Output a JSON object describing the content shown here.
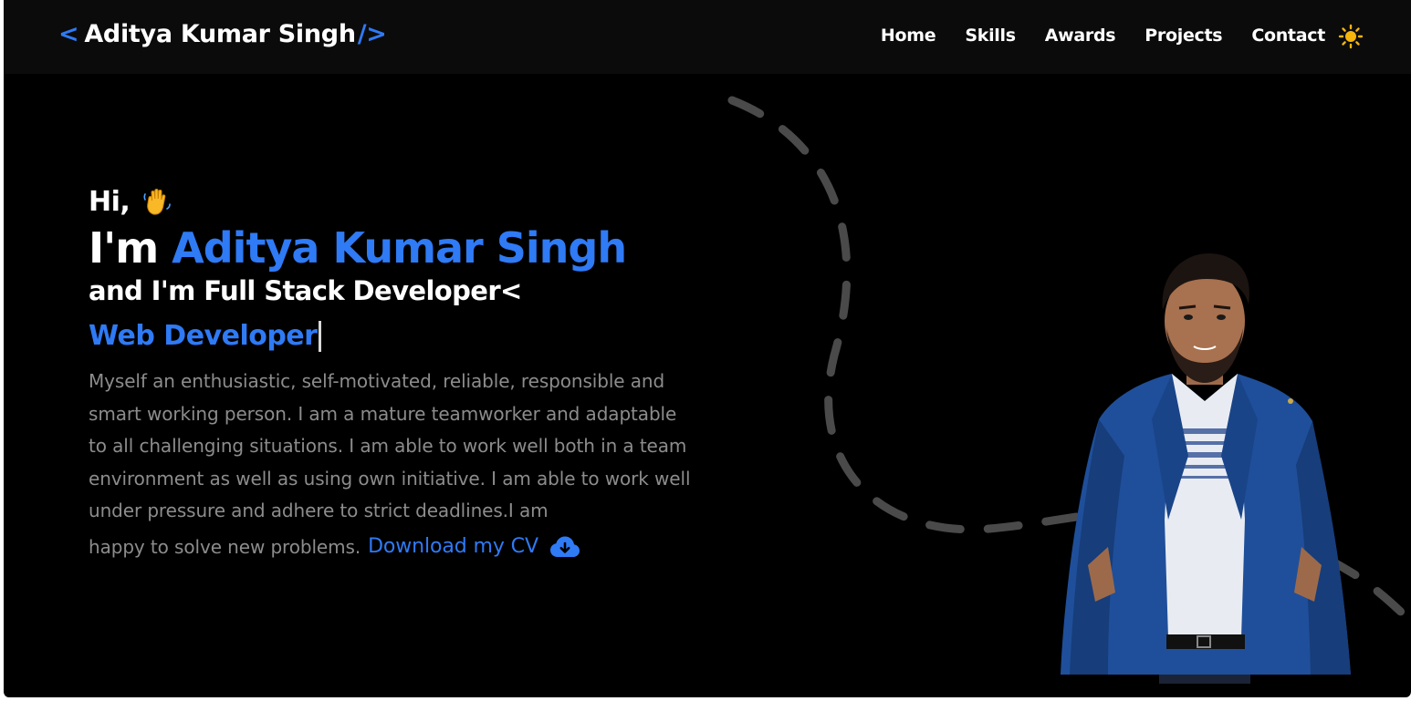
{
  "header": {
    "brand_open": "<",
    "brand_name": "Aditya Kumar Singh",
    "brand_close": "/>",
    "nav": [
      {
        "label": "Home"
      },
      {
        "label": "Skills"
      },
      {
        "label": "Awards"
      },
      {
        "label": "Projects"
      },
      {
        "label": "Contact"
      }
    ],
    "theme_icon": "sun-icon"
  },
  "hero": {
    "greeting": "Hi,",
    "greeting_icon": "waving-hand-icon",
    "intro_prefix": "I'm",
    "name": "Aditya Kumar Singh",
    "role_line": "and I'm Full Stack Developer<",
    "typed_text": "Web Developer",
    "about": "Myself an enthusiastic, self-motivated, reliable, responsible and smart working person. I am a mature teamworker and adaptable to all challenging situations. I am able to work well both in a team environment as well as using own initiative. I am able to work well under pressure and adhere to strict deadlines.I am",
    "about_tail": "happy to solve new problems.",
    "cv_link": "Download my CV",
    "cv_icon": "cloud-download-icon",
    "portrait": "profile-photo"
  },
  "colors": {
    "accent": "#2f7af5",
    "background": "#000000",
    "navbar": "#0b0b0b",
    "body_text": "#8c8c8c",
    "sun": "#f5b50c"
  }
}
